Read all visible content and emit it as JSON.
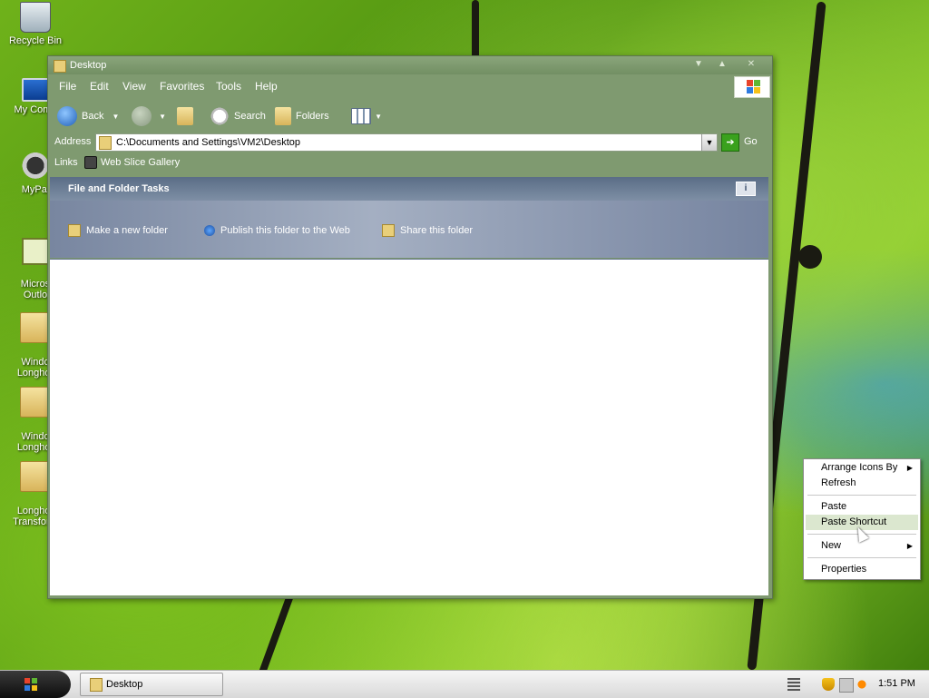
{
  "desktop": {
    "icons": [
      {
        "label": "Recycle Bin",
        "icon": "recycle-bin-icon"
      },
      {
        "label": "My Comp",
        "icon": "my-computer-icon"
      },
      {
        "label": "MyPal",
        "icon": "mypal-icon"
      },
      {
        "label": "Micros\nOutlo",
        "icon": "outlook-icon"
      },
      {
        "label": "Windo\nLonghor",
        "icon": "folder-icon"
      },
      {
        "label": "Windo\nLonghor",
        "icon": "folder-icon"
      },
      {
        "label": "Longhor\nTransform",
        "icon": "folder-icon"
      }
    ]
  },
  "window": {
    "title": "Desktop",
    "menu": [
      "File",
      "Edit",
      "View",
      "Favorites",
      "Tools",
      "Help"
    ],
    "toolbar": {
      "back": "Back",
      "search": "Search",
      "folders": "Folders"
    },
    "address": {
      "label": "Address",
      "value": "C:\\Documents and Settings\\VM2\\Desktop",
      "go": "Go"
    },
    "links": {
      "label": "Links",
      "item": "Web Slice Gallery"
    },
    "tasks": {
      "header": "File and Folder Tasks",
      "items": [
        "Make a new folder",
        "Publish this folder to the Web",
        "Share this folder"
      ]
    }
  },
  "context_menu": {
    "items": [
      {
        "label": "Arrange Icons By",
        "submenu": true
      },
      {
        "label": "Refresh",
        "submenu": false
      },
      {
        "label": "Paste",
        "submenu": false
      },
      {
        "label": "Paste Shortcut",
        "submenu": false,
        "highlighted": true
      },
      {
        "label": "New",
        "submenu": true
      },
      {
        "label": "Properties",
        "submenu": false
      }
    ]
  },
  "taskbar": {
    "task_label": "Desktop",
    "clock": "1:51 PM"
  },
  "colors": {
    "window_frame": "#7f9a70",
    "task_header": "#5a6d86",
    "menu_highlight": "#dbe7cf"
  }
}
